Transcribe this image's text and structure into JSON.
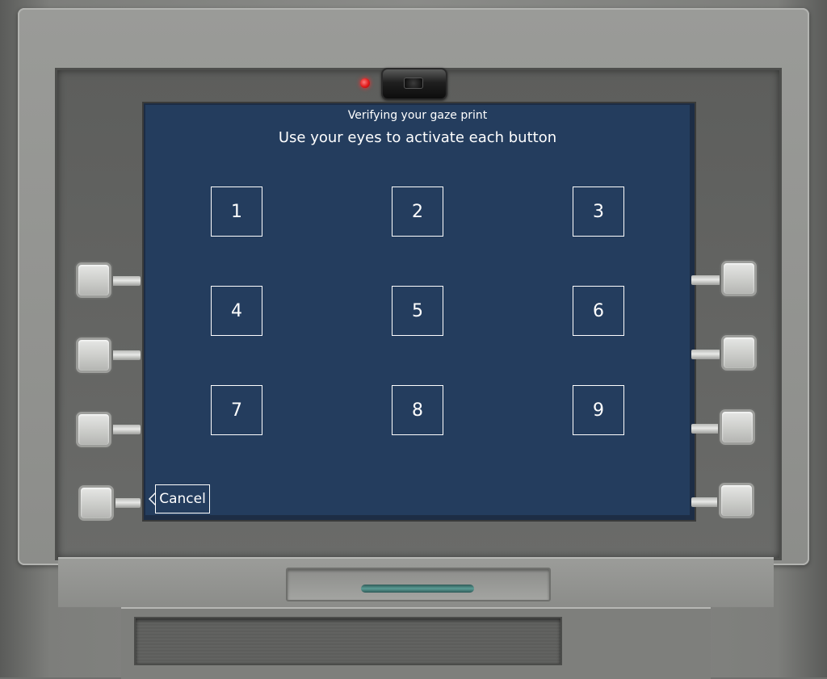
{
  "screen": {
    "status": "Verifying your gaze print",
    "instruction": "Use your eyes to activate each button"
  },
  "keypad": {
    "keys": [
      "1",
      "2",
      "3",
      "4",
      "5",
      "6",
      "7",
      "8",
      "9"
    ]
  },
  "cancel": {
    "label": "Cancel"
  },
  "colors": {
    "screen_background": "#243d5e",
    "text": "#ffffff",
    "indicator_led": "#e21a1a"
  }
}
